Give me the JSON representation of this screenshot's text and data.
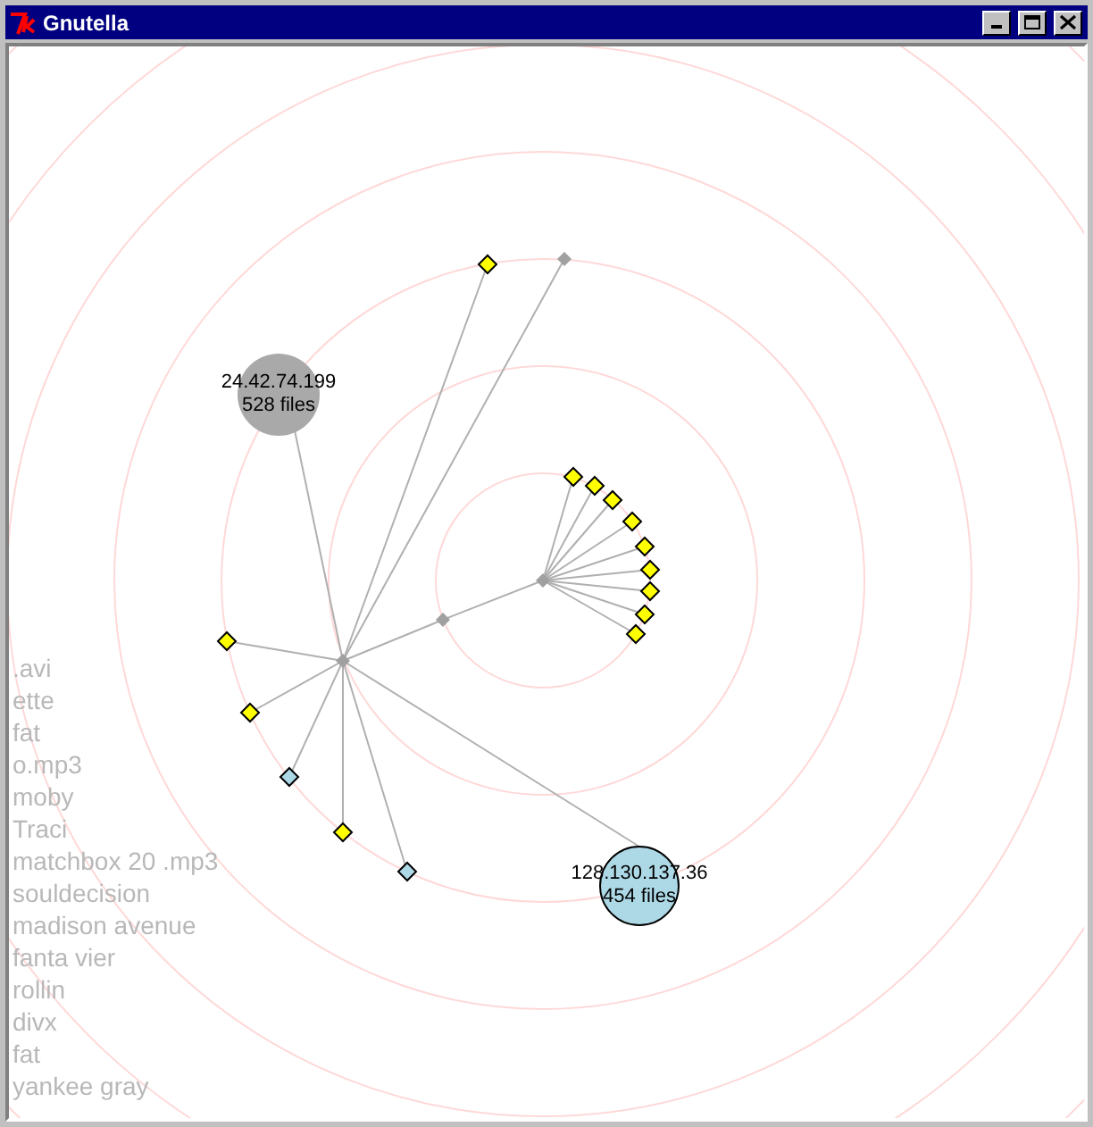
{
  "window": {
    "title": "Gnutella"
  },
  "graph": {
    "hosts": [
      {
        "address": "24.42.74.199",
        "files": "528 files",
        "color": "#a9a9a9"
      },
      {
        "address": "128.130.137.36",
        "files": "454 files",
        "color": "#add8e6"
      }
    ],
    "peers": [
      {
        "color": "#ffff00"
      },
      {
        "color": "#ffff00"
      },
      {
        "color": "#ffff00"
      },
      {
        "color": "#ffff00"
      },
      {
        "color": "#add8e6"
      },
      {
        "color": "#add8e6"
      },
      {
        "color": "#ffff00"
      },
      {
        "color": "#ffff00"
      },
      {
        "color": "#ffff00"
      },
      {
        "color": "#ffff00"
      },
      {
        "color": "#ffff00"
      },
      {
        "color": "#ffff00"
      },
      {
        "color": "#ffff00"
      },
      {
        "color": "#ffff00"
      },
      {
        "color": "#ffff00"
      }
    ]
  },
  "queries": [
    ".avi",
    "ette",
    "fat",
    "o.mp3",
    "moby",
    "Traci",
    "matchbox 20 .mp3",
    "souldecision",
    "madison avenue",
    "fanta vier",
    "rollin",
    "divx",
    "fat",
    "yankee gray"
  ]
}
